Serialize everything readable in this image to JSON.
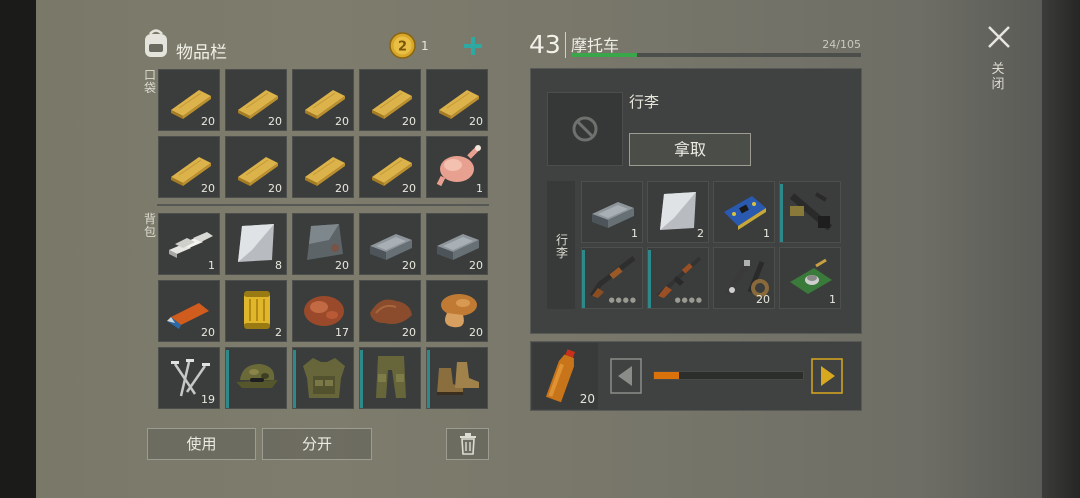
{
  "inventory": {
    "title": "物品栏",
    "coins": "1",
    "pocket_label": "口袋",
    "backpack_label": "背包",
    "pocket_items": [
      {
        "icon": "wood-plank-icon",
        "count": "20"
      },
      {
        "icon": "wood-plank-icon",
        "count": "20"
      },
      {
        "icon": "wood-plank-icon",
        "count": "20"
      },
      {
        "icon": "wood-plank-icon",
        "count": "20"
      },
      {
        "icon": "wood-plank-icon",
        "count": "20"
      },
      {
        "icon": "wood-plank-icon",
        "count": "20"
      },
      {
        "icon": "wood-plank-icon",
        "count": "20"
      },
      {
        "icon": "wood-plank-icon",
        "count": "20"
      },
      {
        "icon": "wood-plank-icon",
        "count": "20"
      },
      {
        "icon": "raw-chicken-icon",
        "count": "1"
      }
    ],
    "backpack_items": [
      {
        "icon": "aluminum-bars-icon",
        "count": "1"
      },
      {
        "icon": "metal-sheet-icon",
        "count": "8"
      },
      {
        "icon": "iron-plate-icon",
        "count": "20"
      },
      {
        "icon": "steel-ingot-icon",
        "count": "20"
      },
      {
        "icon": "steel-ingot-icon",
        "count": "20"
      },
      {
        "icon": "usb-drive-icon",
        "count": "20"
      },
      {
        "icon": "fuel-filter-icon",
        "count": "2"
      },
      {
        "icon": "raw-meat-icon",
        "count": "17"
      },
      {
        "icon": "leather-icon",
        "count": "20"
      },
      {
        "icon": "mushroom-icon",
        "count": "20"
      },
      {
        "icon": "nails-icon",
        "count": "19"
      },
      {
        "icon": "camo-cap-icon",
        "count": ""
      },
      {
        "icon": "camo-vest-icon",
        "count": ""
      },
      {
        "icon": "camo-pants-icon",
        "count": ""
      },
      {
        "icon": "boots-icon",
        "count": ""
      }
    ],
    "use_label": "使用",
    "split_label": "分开"
  },
  "vehicle": {
    "level": "43",
    "name": "摩托车",
    "capacity": "24/105",
    "capacity_fraction": 0.229,
    "luggage_title": "行李",
    "take_label": "拿取",
    "trunk_label": "行李",
    "trunk_items": [
      {
        "icon": "steel-ingot-icon",
        "count": "1"
      },
      {
        "icon": "metal-sheet-icon",
        "count": "2"
      },
      {
        "icon": "circuit-board-icon",
        "count": "1"
      },
      {
        "icon": "motorcycle-handlebar-icon",
        "count": ""
      },
      {
        "icon": "shotgun-icon",
        "count": ""
      },
      {
        "icon": "ak-rifle-icon",
        "count": ""
      },
      {
        "icon": "spark-plug-parts-icon",
        "count": "20"
      },
      {
        "icon": "electronic-module-icon",
        "count": "1"
      }
    ]
  },
  "fuel": {
    "item_icon": "gasoline-bottle-icon",
    "count": "20",
    "fill_fraction": 0.17
  },
  "close_label": "关闭",
  "colors": {
    "capacity_bar": "#3aa64a",
    "fuel_bar": "#d9720a",
    "arrow_active": "#d8a820",
    "teal_marker": "#2e8a8a"
  }
}
